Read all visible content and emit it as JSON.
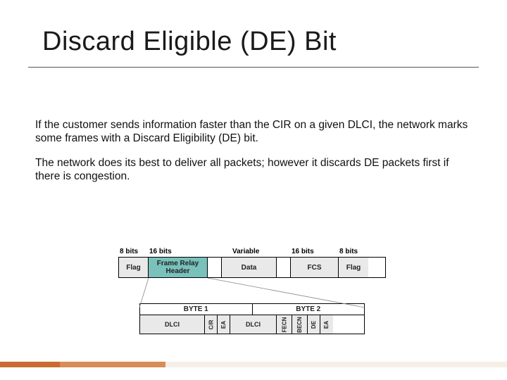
{
  "title": "Discard Eligible (DE) Bit",
  "paragraphs": {
    "p1": "If the customer sends information faster than the CIR on a given DLCI, the network marks some frames with a Discard Eligibility (DE) bit.",
    "p2": "The network does its best to deliver all packets; however it discards DE packets first if there is congestion."
  },
  "frame": {
    "widths": {
      "flag1": "8 bits",
      "header": "16 bits",
      "data": "Variable",
      "fcs": "16 bits",
      "flag2": "8 bits"
    },
    "cells": {
      "flag1": "Flag",
      "header": "Frame Relay Header",
      "data": "Data",
      "fcs": "FCS",
      "flag2": "Flag"
    }
  },
  "header_bytes": {
    "b1": "BYTE 1",
    "b2": "BYTE 2"
  },
  "header_fields": {
    "dlci1": "DLCI",
    "cr": "C/R",
    "ea1": "EA",
    "dlci2": "DLCI",
    "fecn": "FECN",
    "becn": "BECN",
    "de": "DE",
    "ea2": "EA"
  }
}
